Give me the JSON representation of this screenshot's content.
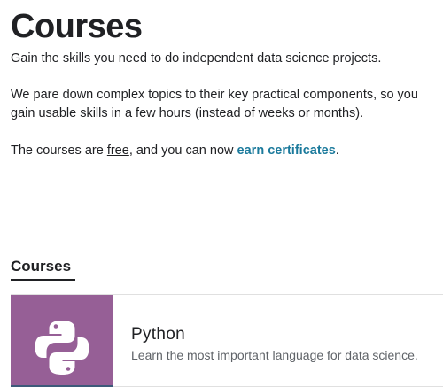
{
  "header": {
    "title": "Courses"
  },
  "intro": {
    "paragraph1": "Gain the skills you need to do independent data science projects.",
    "paragraph2": "We pare down complex topics to their key practical components, so you gain usable skills in a few hours (instead of weeks or months).",
    "paragraph3_prefix": "The courses are ",
    "paragraph3_free": "free",
    "paragraph3_middle": ", and you can now ",
    "paragraph3_link": "earn certificates",
    "paragraph3_suffix": "."
  },
  "section": {
    "heading": "Courses"
  },
  "courses": [
    {
      "title": "Python",
      "description": "Learn the most important language for data science.",
      "icon": "python-logo-icon",
      "thumb_color": "#965f96",
      "thumb_bottom_color": "#3d5a7a"
    }
  ],
  "colors": {
    "link": "#1b7a9c",
    "text": "#202124",
    "muted": "#5f6368"
  }
}
